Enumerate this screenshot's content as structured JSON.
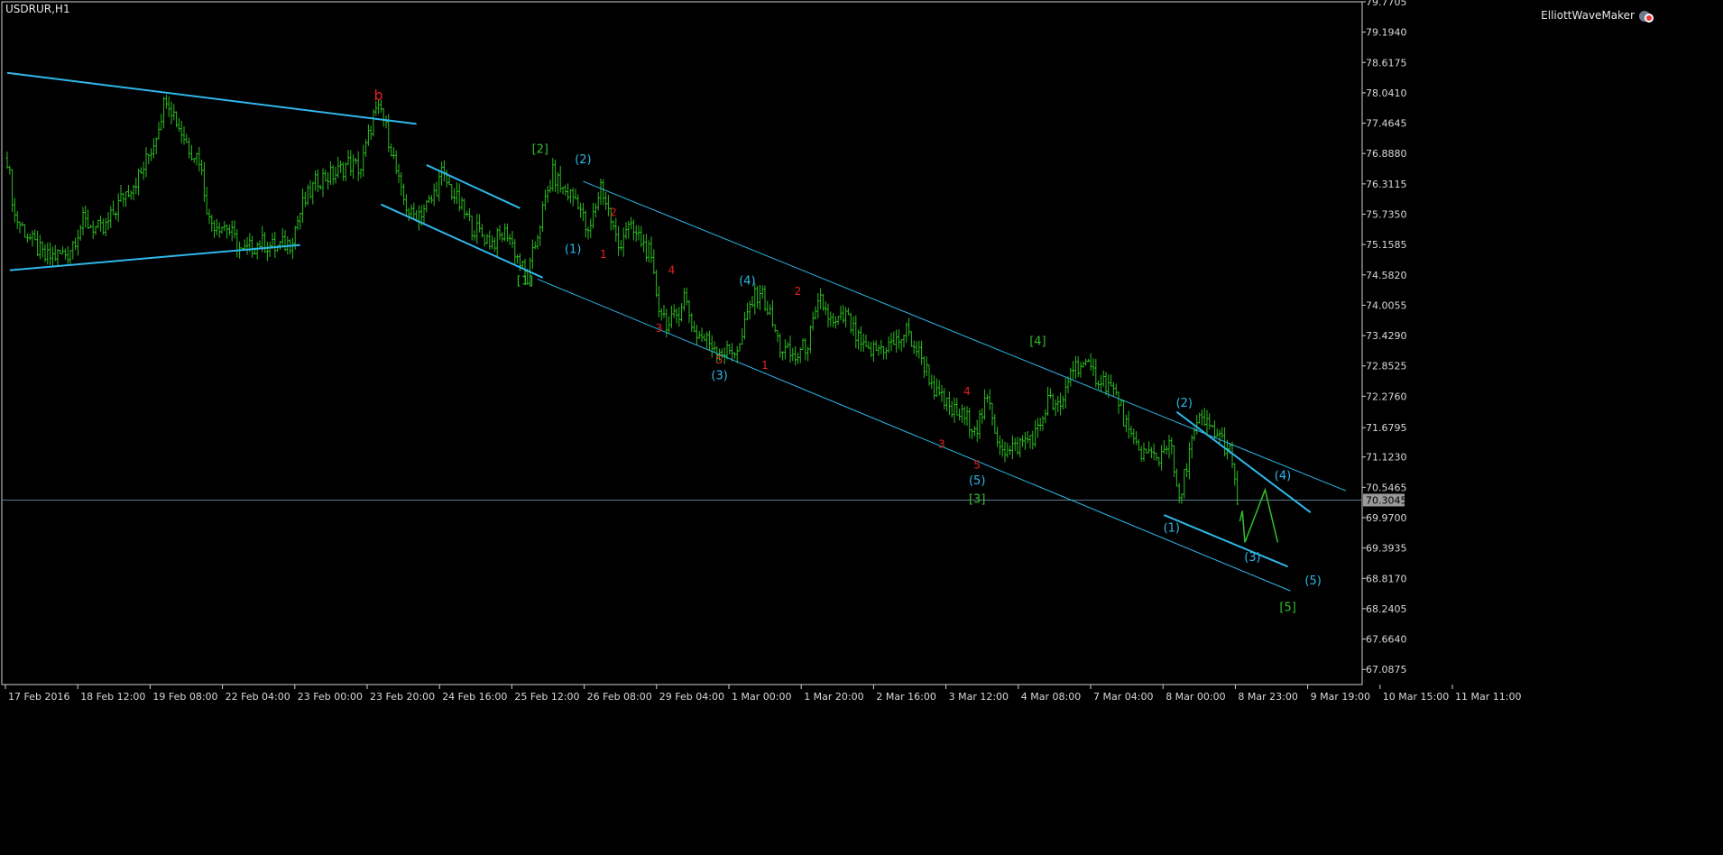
{
  "header": {
    "symbol_label": "USDRUR,H1",
    "indicator_label": "ElliottWaveMaker"
  },
  "colors": {
    "background": "#000000",
    "frame": "#d0d0d0",
    "bars": "#2bbd20",
    "channel": "#2fb7e9",
    "wave_minor": "#e82020",
    "wave_intermediate": "#2fb7e9",
    "wave_primary": "#32c02a",
    "current_price_line": "#5a7f8a",
    "current_price_tag_bg": "#9a9a9a"
  },
  "chart_data": {
    "type": "ohlc",
    "symbol": "USDRUR",
    "timeframe": "H1",
    "ylim": [
      66.8,
      79.77
    ],
    "current_price": 70.3045,
    "y_ticks": [
      "79.7705",
      "79.1940",
      "78.6175",
      "78.0410",
      "77.4645",
      "76.8880",
      "76.3115",
      "75.7350",
      "75.1585",
      "74.5820",
      "74.0055",
      "73.4290",
      "72.8525",
      "72.2760",
      "71.6795",
      "71.1230",
      "70.5465",
      "69.9700",
      "69.3935",
      "68.8170",
      "68.2405",
      "67.6640",
      "67.0875"
    ],
    "x_ticks": [
      "17 Feb 2016",
      "18 Feb 12:00",
      "19 Feb 08:00",
      "22 Feb 04:00",
      "23 Feb 00:00",
      "23 Feb 20:00",
      "24 Feb 16:00",
      "25 Feb 12:00",
      "26 Feb 08:00",
      "29 Feb 04:00",
      "1 Mar 00:00",
      "1 Mar 20:00",
      "2 Mar 16:00",
      "3 Mar 12:00",
      "4 Mar 08:00",
      "7 Mar 04:00",
      "8 Mar 00:00",
      "8 Mar 23:00",
      "9 Mar 19:00",
      "10 Mar 15:00",
      "11 Mar 11:00"
    ],
    "price_path": [
      [
        0,
        76.8
      ],
      [
        3,
        75.7
      ],
      [
        10,
        75.2
      ],
      [
        15,
        74.9
      ],
      [
        24,
        75.0
      ],
      [
        30,
        75.6
      ],
      [
        38,
        75.4
      ],
      [
        46,
        76.1
      ],
      [
        53,
        76.5
      ],
      [
        58,
        77.1
      ],
      [
        63,
        78.0
      ],
      [
        68,
        77.4
      ],
      [
        72,
        77.0
      ],
      [
        76,
        76.8
      ],
      [
        80,
        75.6
      ],
      [
        87,
        75.5
      ],
      [
        93,
        75.0
      ],
      [
        100,
        75.2
      ],
      [
        106,
        75.1
      ],
      [
        112,
        75.2
      ],
      [
        117,
        75.9
      ],
      [
        123,
        76.4
      ],
      [
        130,
        76.5
      ],
      [
        135,
        76.7
      ],
      [
        140,
        76.6
      ],
      [
        145,
        77.6
      ],
      [
        148,
        77.7
      ],
      [
        152,
        77.0
      ],
      [
        156,
        76.1
      ],
      [
        160,
        75.7
      ],
      [
        164,
        75.8
      ],
      [
        168,
        76.0
      ],
      [
        172,
        76.5
      ],
      [
        178,
        76.0
      ],
      [
        184,
        75.5
      ],
      [
        192,
        75.2
      ],
      [
        198,
        75.4
      ],
      [
        203,
        74.8
      ],
      [
        206,
        74.5
      ],
      [
        212,
        75.8
      ],
      [
        216,
        76.5
      ],
      [
        220,
        76.2
      ],
      [
        226,
        76.0
      ],
      [
        230,
        75.3
      ],
      [
        235,
        76.3
      ],
      [
        238,
        75.8
      ],
      [
        242,
        75.1
      ],
      [
        245,
        75.5
      ],
      [
        250,
        75.3
      ],
      [
        254,
        75.0
      ],
      [
        258,
        74.0
      ],
      [
        262,
        73.6
      ],
      [
        266,
        73.9
      ],
      [
        268,
        74.2
      ],
      [
        272,
        73.5
      ],
      [
        278,
        73.3
      ],
      [
        284,
        73.1
      ],
      [
        290,
        73.2
      ],
      [
        294,
        74.0
      ],
      [
        298,
        74.3
      ],
      [
        302,
        73.8
      ],
      [
        306,
        73.2
      ],
      [
        312,
        73.0
      ],
      [
        317,
        73.3
      ],
      [
        322,
        74.1
      ],
      [
        327,
        73.6
      ],
      [
        332,
        73.8
      ],
      [
        336,
        73.4
      ],
      [
        340,
        73.1
      ],
      [
        346,
        73.2
      ],
      [
        352,
        73.3
      ],
      [
        356,
        73.5
      ],
      [
        362,
        73.0
      ],
      [
        368,
        72.3
      ],
      [
        374,
        72.0
      ],
      [
        378,
        71.9
      ],
      [
        384,
        71.7
      ],
      [
        388,
        72.2
      ],
      [
        392,
        71.5
      ],
      [
        396,
        71.2
      ],
      [
        402,
        71.4
      ],
      [
        408,
        71.6
      ],
      [
        412,
        72.2
      ],
      [
        417,
        72.0
      ],
      [
        421,
        72.8
      ],
      [
        425,
        72.9
      ],
      [
        430,
        72.7
      ],
      [
        436,
        72.5
      ],
      [
        440,
        72.2
      ],
      [
        445,
        71.4
      ],
      [
        450,
        71.2
      ],
      [
        456,
        71.1
      ],
      [
        460,
        71.5
      ],
      [
        464,
        70.2
      ],
      [
        468,
        71.3
      ],
      [
        472,
        71.8
      ],
      [
        476,
        71.7
      ],
      [
        480,
        71.5
      ],
      [
        484,
        71.2
      ],
      [
        488,
        70.0
      ]
    ],
    "channels": [
      {
        "from": [
          0,
          78.42
        ],
        "to": [
          162,
          77.45
        ],
        "heavy": true
      },
      {
        "from": [
          1,
          74.67
        ],
        "to": [
          116,
          75.15
        ],
        "heavy": true
      },
      {
        "from": [
          166,
          76.67
        ],
        "to": [
          203,
          75.85
        ],
        "heavy": true
      },
      {
        "from": [
          148,
          75.92
        ],
        "to": [
          212,
          74.53
        ],
        "heavy": true
      },
      {
        "from": [
          228,
          76.36
        ],
        "to": [
          530,
          70.48
        ],
        "heavy": false
      },
      {
        "from": [
          210,
          74.5
        ],
        "to": [
          508,
          68.58
        ],
        "heavy": false
      },
      {
        "from": [
          463,
          71.98
        ],
        "to": [
          516,
          70.07
        ],
        "heavy": true
      },
      {
        "from": [
          458,
          70.02
        ],
        "to": [
          507,
          69.04
        ],
        "heavy": true
      }
    ],
    "projection": [
      [
        488,
        69.9
      ],
      [
        489,
        70.1
      ],
      [
        490,
        69.5
      ],
      [
        498,
        70.5
      ],
      [
        503,
        69.5
      ]
    ],
    "wave_labels": [
      {
        "text": "b",
        "x": 147,
        "y": 77.9,
        "color": "wave_minor",
        "size": 16
      },
      {
        "text": "[2]",
        "x": 211,
        "y": 76.9,
        "color": "wave_primary",
        "size": 13
      },
      {
        "text": "(2)",
        "x": 228,
        "y": 76.7,
        "color": "wave_intermediate",
        "size": 13
      },
      {
        "text": "(1)",
        "x": 224,
        "y": 75.0,
        "color": "wave_intermediate",
        "size": 13
      },
      {
        "text": "[1]",
        "x": 205,
        "y": 74.4,
        "color": "wave_primary",
        "size": 13
      },
      {
        "text": "2",
        "x": 240,
        "y": 75.7,
        "color": "wave_minor",
        "size": 12
      },
      {
        "text": "1",
        "x": 236,
        "y": 74.9,
        "color": "wave_minor",
        "size": 12
      },
      {
        "text": "4",
        "x": 263,
        "y": 74.6,
        "color": "wave_minor",
        "size": 12
      },
      {
        "text": "3",
        "x": 258,
        "y": 73.5,
        "color": "wave_minor",
        "size": 12
      },
      {
        "text": "5",
        "x": 282,
        "y": 72.9,
        "color": "wave_minor",
        "size": 12
      },
      {
        "text": "(3)",
        "x": 282,
        "y": 72.6,
        "color": "wave_intermediate",
        "size": 13
      },
      {
        "text": "(4)",
        "x": 293,
        "y": 74.4,
        "color": "wave_intermediate",
        "size": 13
      },
      {
        "text": "2",
        "x": 313,
        "y": 74.2,
        "color": "wave_minor",
        "size": 12
      },
      {
        "text": "1",
        "x": 300,
        "y": 72.8,
        "color": "wave_minor",
        "size": 12
      },
      {
        "text": "4",
        "x": 380,
        "y": 72.3,
        "color": "wave_minor",
        "size": 12
      },
      {
        "text": "3",
        "x": 370,
        "y": 71.3,
        "color": "wave_minor",
        "size": 12
      },
      {
        "text": "5",
        "x": 384,
        "y": 70.9,
        "color": "wave_minor",
        "size": 12
      },
      {
        "text": "(5)",
        "x": 384,
        "y": 70.6,
        "color": "wave_intermediate",
        "size": 13
      },
      {
        "text": "[3]",
        "x": 384,
        "y": 70.25,
        "color": "wave_primary",
        "size": 13
      },
      {
        "text": "[4]",
        "x": 408,
        "y": 73.25,
        "color": "wave_primary",
        "size": 13
      },
      {
        "text": "(2)",
        "x": 466,
        "y": 72.08,
        "color": "wave_intermediate",
        "size": 13
      },
      {
        "text": "(1)",
        "x": 461,
        "y": 69.7,
        "color": "wave_intermediate",
        "size": 13
      },
      {
        "text": "(3)",
        "x": 493,
        "y": 69.15,
        "color": "wave_intermediate",
        "size": 13
      },
      {
        "text": "(4)",
        "x": 505,
        "y": 70.7,
        "color": "wave_intermediate",
        "size": 13
      },
      {
        "text": "(5)",
        "x": 517,
        "y": 68.7,
        "color": "wave_intermediate",
        "size": 13
      },
      {
        "text": "[5]",
        "x": 507,
        "y": 68.2,
        "color": "wave_primary",
        "size": 13
      }
    ]
  }
}
